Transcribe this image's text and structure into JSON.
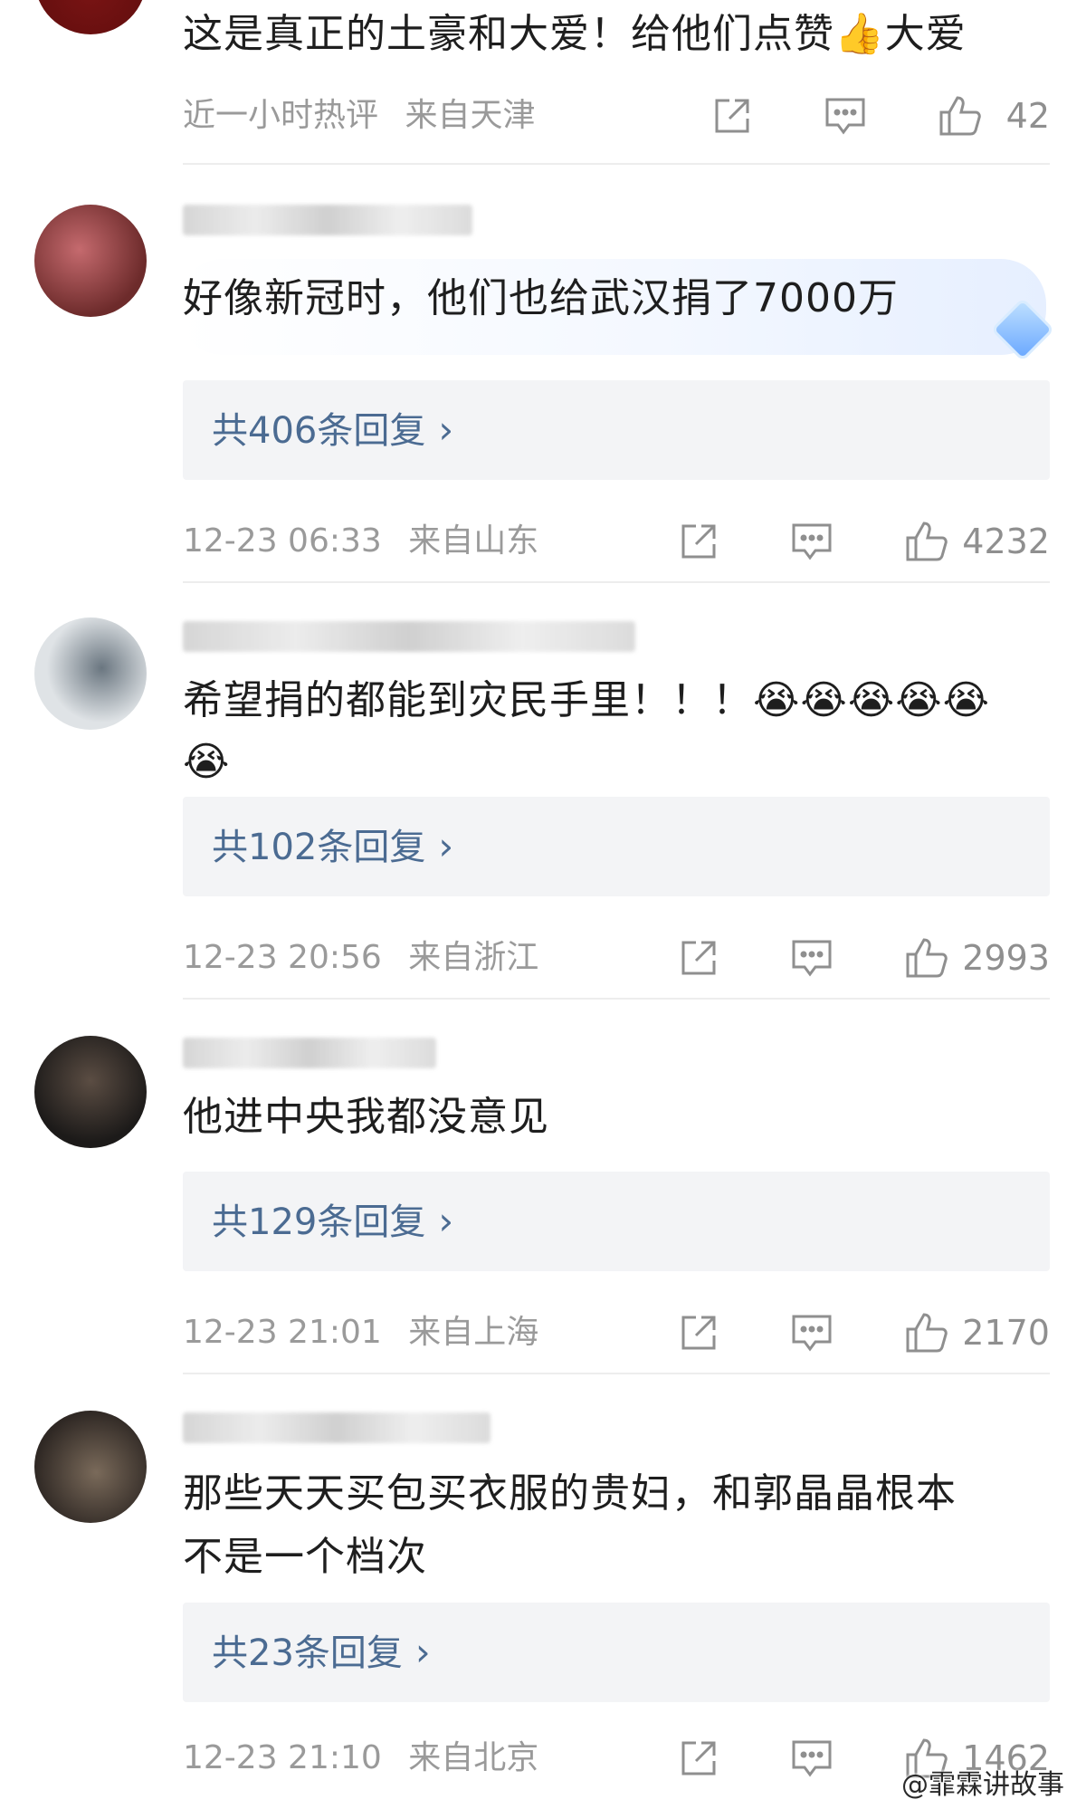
{
  "comments": [
    {
      "text": "这是真正的土豪和大爱！给他们点赞👍大爱",
      "meta_time": "近一小时热评",
      "meta_location": "来自天津",
      "likes": "42"
    },
    {
      "text": "好像新冠时，他们也给武汉捐了7000万",
      "replies": "共406条回复",
      "meta_time": "12-23 06:33",
      "meta_location": "来自山东",
      "likes": "4232"
    },
    {
      "text": "希望捐的都能到灾民手里！！！😭😭😭😭😭",
      "text2": "😭",
      "replies": "共102条回复",
      "meta_time": "12-23 20:56",
      "meta_location": "来自浙江",
      "likes": "2993"
    },
    {
      "text": "他进中央我都没意见",
      "replies": "共129条回复",
      "meta_time": "12-23 21:01",
      "meta_location": "来自上海",
      "likes": "2170"
    },
    {
      "text": "那些天天买包买衣服的贵妇，和郭晶晶根本",
      "text2": "不是一个档次",
      "replies": "共23条回复",
      "meta_time": "12-23 21:10",
      "meta_location": "来自北京",
      "likes": "1462"
    }
  ],
  "reply_chevron": "›",
  "watermark": "@霏霖讲故事",
  "colors": {
    "reply_link": "#4b6b92",
    "meta": "#9a9a9a",
    "reply_box_bg": "#f3f4f6"
  }
}
